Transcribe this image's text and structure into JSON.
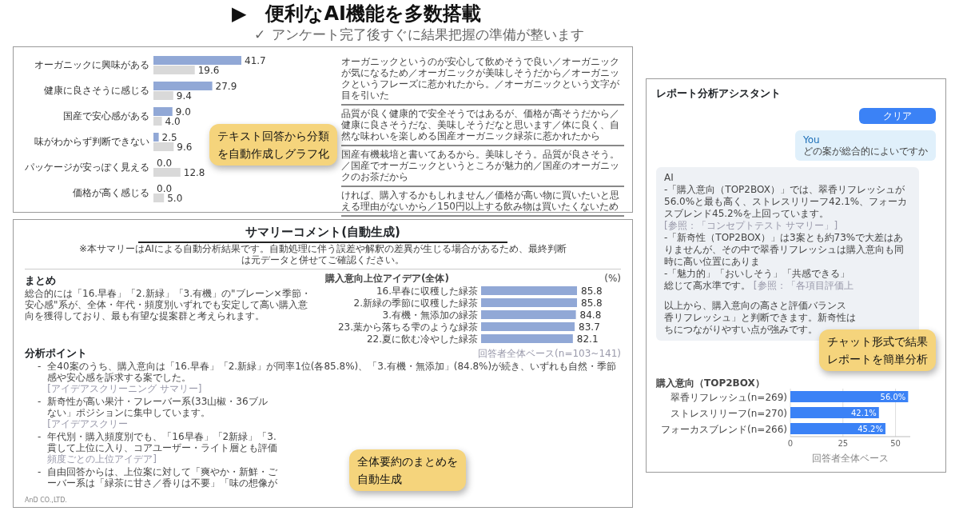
{
  "header": {
    "marker": "▶",
    "title": "便利なAI機能を多数搭載",
    "check": "✓",
    "subtitle": "アンケート完了後すぐに結果把握の準備が整います"
  },
  "analysis_panel": {
    "chart_data": {
      "type": "bar",
      "orientation": "horizontal",
      "categories": [
        "オーガニックに興味がある",
        "健康に良さそうに感じる",
        "国産で安心感がある",
        "味がわからず判断できない",
        "パッケージが安っぽく見える",
        "価格が高く感じる"
      ],
      "series": [
        {
          "color": "#91a8d6",
          "values": [
            41.7,
            27.9,
            9.0,
            2.5,
            0.0,
            0.0
          ],
          "value_labels": [
            "41.7",
            "27.9",
            "9.0",
            "2.5",
            "0.0",
            "0.0"
          ]
        },
        {
          "color": "#d9d9d9",
          "values": [
            19.6,
            9.4,
            4.0,
            9.6,
            12.8,
            5.0
          ],
          "value_labels": [
            "19.6",
            "9.4",
            "4.0",
            "9.6",
            "12.8",
            "5.0"
          ]
        }
      ],
      "data_labels": true
    },
    "comments": [
      "オーガニックというのが安心して飲めそうで良い／オーガニックが気になるため／オーガニックが美味しそうだから／オーガニックというフレーズに惹かれたから。／オーガニックという文字が目を引いた",
      "品質が良く健康的で安全そうではあるが、価格が高そうだから／健康に良さそうだな、美味しそうだなと思います／体に良く、自然な味わいを楽しめる国産オーガニック緑茶に惹かれたから",
      "国産有機栽培と書いてあるから。美味しそう。品質が良さそう。／国産でオーガニックというところが魅力的／国産のオーガニックのお茶だから",
      "ければ、購入するかもしれません／価格が高い物に買いたいと思える理由がないから／150円以上する飲み物は買いたくないため"
    ],
    "callout": [
      "テキスト回答から分類",
      "を自動作成しグラフ化"
    ]
  },
  "chat_panel": {
    "title": "レポート分析アシスタント",
    "clear_button": "クリア",
    "messages": [
      {
        "kind": "user",
        "sender": "You",
        "text": "どの案が総合的によいですか"
      },
      {
        "kind": "ai",
        "sender": "AI",
        "lines": [
          {
            "text": "-「購入意向（TOP2BOX）」では、翠香リフレッシュが56.0%と最も高く、ストレスリリーフ42.1%、フォーカスブレンド45.2%を上回っています。",
            "ref": "[参照：「コンセプトテスト サマリー」]"
          },
          {
            "text": "-「新奇性（TOP2BOX）」は3案とも約73%で大差はありませんが、その中で翠香リフレッシュは購入意向も同時に高い位置にありま"
          },
          {
            "text": "-「魅力的」「おいしそう」「共感できる」"
          },
          {
            "text": "総じて高水準です。",
            "ref": "[参照：「各項目評価上"
          },
          {
            "text": "以上から、購入意向の高さと評価バランス",
            "gap": true
          },
          {
            "text": "香リフレッシュ」と判断できます。新奇性は"
          },
          {
            "text": "ちにつながりやすい点が強みです。"
          }
        ]
      }
    ],
    "chart_data": {
      "type": "bar",
      "orientation": "horizontal",
      "title": "購入意向（TOP2BOX）",
      "categories": [
        "翠香リフレッシュ(n=269)",
        "ストレスリリーフ(n=270)",
        "フォーカスブレンド(n=266)"
      ],
      "series": [
        {
          "color": "#3b82f6",
          "values": [
            56.0,
            42.1,
            45.2
          ]
        }
      ],
      "value_labels": [
        "56.0%",
        "42.1%",
        "45.2%"
      ],
      "xlim": [
        0,
        57
      ],
      "xticks": [
        0,
        25,
        50
      ],
      "xlabel": "回答者全体ベース"
    },
    "callout": [
      "チャット形式で結果",
      "レポートを簡単分析"
    ]
  },
  "summary_panel": {
    "title": "サマリーコメント(自動生成)",
    "note": "※本サマリーはAIによる自動分析結果です。自動処理に伴う誤差や解釈の差異が生じる場合があるため、最終判断は元データと併せてご確認ください。",
    "matome": {
      "heading": "まとめ",
      "text": "総合的には「16.早春」「2.新緑」「3.有機」の\"ブレーン×季節・安心感\"系が、全体・年代・頻度別いずれでも安定して高い購入意向を獲得しており、最も有望な提案群と考えられます。"
    },
    "chart_data": {
      "type": "bar",
      "orientation": "horizontal",
      "title": "購入意向上位アイデア(全体)",
      "ylabel": "(%)",
      "categories": [
        "16.早春に収穫した緑茶",
        "2.新緑の季節に収穫した緑茶",
        "3.有機・無添加の緑茶",
        "23.葉から落ちる雫のような緑茶",
        "22.夏に飲む冷やした緑茶"
      ],
      "series": [
        {
          "color": "#91a8d6",
          "values": [
            85.8,
            85.8,
            84.8,
            83.7,
            82.1
          ]
        }
      ],
      "data_labels": true,
      "value_labels": [
        "85.8",
        "85.8",
        "84.8",
        "83.7",
        "82.1"
      ]
    },
    "base_note": "回答者全体ベース(n=103~141)",
    "points": {
      "heading": "分析ポイント",
      "marker": "-",
      "items": [
        {
          "lines": [
            "全40案のうち、購入意向は「16.早春」「2.新緑」が同率1位(各85.8%)、「3.有機・無添加」(84.8%)が続き、いずれも自然・季節感や安心感を訴求する案でした。"
          ],
          "ref": "[アイデアスクリーニング サマリー]"
        },
        {
          "lines": [
            "新奇性が高い果汁・フレーバー系(33山椒・36ブル",
            "ない」ポジションに集中しています。"
          ],
          "ref": "[アイデアスクリー"
        },
        {
          "lines": [
            "年代別・購入頻度別でも、「16早春」「2新緑」「3.",
            "貫して上位に入り、コアユーザー・ライト層とも評価"
          ],
          "ref": "頻度ごとの上位アイデア]"
        },
        {
          "lines": [
            "自由回答からは、上位案に対して「爽やか・新鮮・ご",
            "ーバー系は「緑茶に甘さ／香りは不要」「味の想像が"
          ]
        }
      ]
    },
    "footer": "AnD CO.,LTD.",
    "callout": [
      "全体要約のまとめを",
      "自動生成"
    ]
  }
}
